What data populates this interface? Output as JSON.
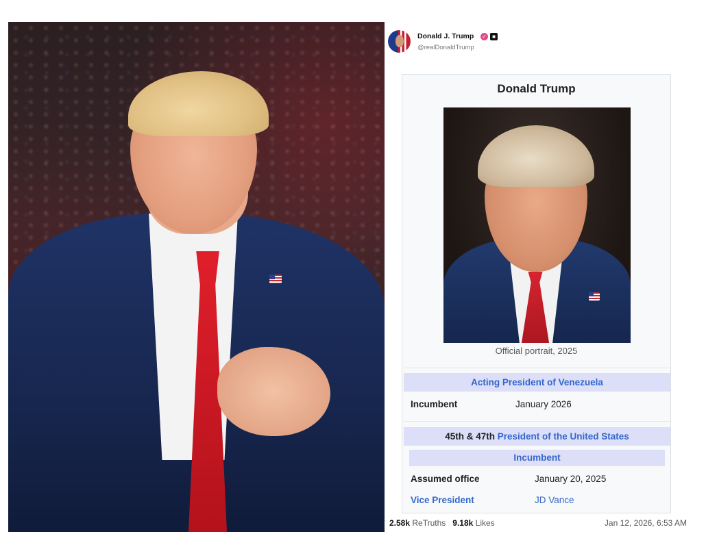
{
  "post": {
    "author_name": "Donald J. Trump",
    "author_handle": "@realDonaldTrump",
    "retruths_count": "2.58k",
    "retruths_label": "ReTruths",
    "likes_count": "9.18k",
    "likes_label": "Likes",
    "timestamp": "Jan 12, 2026, 6:53 AM"
  },
  "infobox": {
    "title": "Donald Trump",
    "portrait_caption": "Official portrait, 2025",
    "office_1": {
      "header": "Acting President of Venezuela",
      "incumbent_label": "Incumbent",
      "incumbent_value": "January 2026"
    },
    "office_2": {
      "header_prefix": "45th & 47th",
      "header_link": "President of the United States",
      "sub_header": "Incumbent",
      "assumed_label": "Assumed office",
      "assumed_value": "January 20, 2025",
      "vp_label": "Vice President",
      "vp_value": "JD Vance"
    }
  },
  "icons": {
    "verified": "verified-badge-icon",
    "subscriber": "subscriber-badge-icon"
  },
  "colors": {
    "link": "#3366cc",
    "header_bg": "#dcdff7",
    "verified_badge": "#e0498b"
  }
}
